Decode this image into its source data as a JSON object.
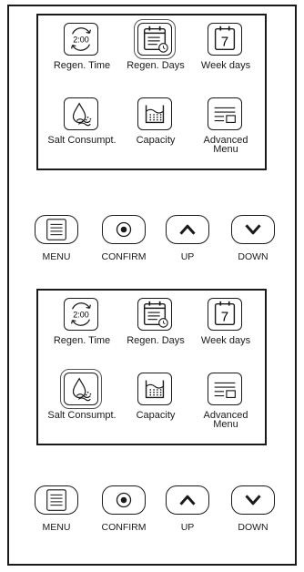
{
  "panels": [
    {
      "menu": {
        "items": [
          {
            "label": "Regen. Time",
            "icon_text": "2:00",
            "icon": "clock-refresh-icon"
          },
          {
            "label": "Regen. Days",
            "icon": "calendar-clock-icon",
            "selected": true
          },
          {
            "label": "Week days",
            "icon_text": "7",
            "icon": "calendar-day-icon"
          },
          {
            "label": "Salt Consumpt.",
            "icon": "salt-drop-icon"
          },
          {
            "label": "Capacity",
            "icon": "capacity-tank-icon"
          },
          {
            "label": "Advanced\nMenu",
            "icon": "advanced-menu-icon"
          }
        ]
      },
      "buttons": [
        {
          "label": "MENU",
          "icon": "menu-lines-icon"
        },
        {
          "label": "CONFIRM",
          "icon": "confirm-dot-icon"
        },
        {
          "label": "UP",
          "icon": "chevron-up-icon"
        },
        {
          "label": "DOWN",
          "icon": "chevron-down-icon"
        }
      ]
    },
    {
      "menu": {
        "items": [
          {
            "label": "Regen. Time",
            "icon_text": "2:00",
            "icon": "clock-refresh-icon"
          },
          {
            "label": "Regen. Days",
            "icon": "calendar-clock-icon"
          },
          {
            "label": "Week days",
            "icon_text": "7",
            "icon": "calendar-day-icon"
          },
          {
            "label": "Salt Consumpt.",
            "icon": "salt-drop-icon",
            "selected": true
          },
          {
            "label": "Capacity",
            "icon": "capacity-tank-icon"
          },
          {
            "label": "Advanced\nMenu",
            "icon": "advanced-menu-icon"
          }
        ]
      },
      "buttons": [
        {
          "label": "MENU",
          "icon": "menu-lines-icon"
        },
        {
          "label": "CONFIRM",
          "icon": "confirm-dot-icon"
        },
        {
          "label": "UP",
          "icon": "chevron-up-icon"
        },
        {
          "label": "DOWN",
          "icon": "chevron-down-icon"
        }
      ]
    }
  ]
}
